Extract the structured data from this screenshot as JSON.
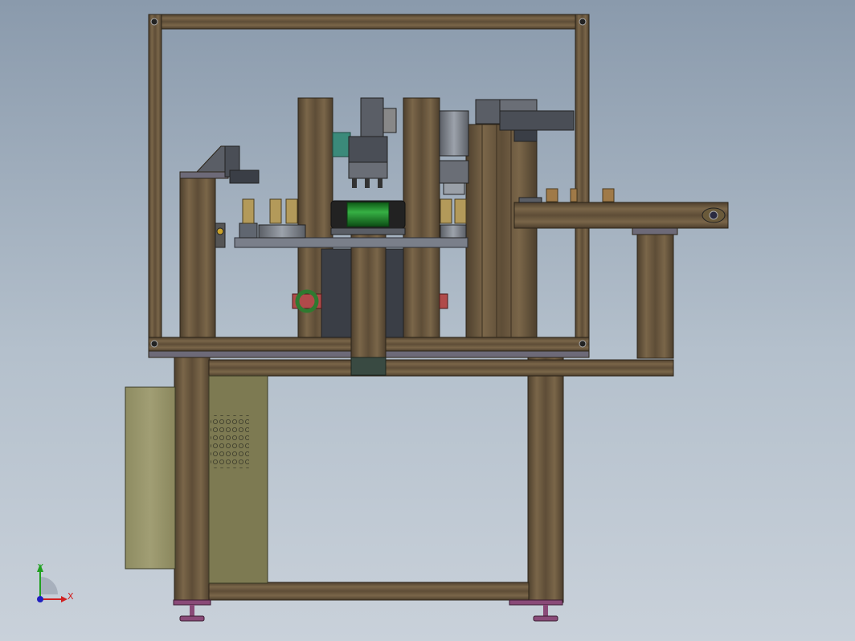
{
  "viewport": {
    "background_top": "#8a9aac",
    "background_bottom": "#c9d1da"
  },
  "colors": {
    "frame": "#6b5a43",
    "frame_dark": "#4a3d2c",
    "plate": "#7a7f8a",
    "cabinet": "#9a9670",
    "cabinet_side": "#7d7a52",
    "roller": "#1f8a2b",
    "foot": "#8a4a78",
    "red_part": "#b04a4a",
    "bronze": "#a07a48"
  },
  "triad": {
    "x_label": "X",
    "y_label": "Y",
    "x_color": "#d02020",
    "y_color": "#20a020",
    "origin_color": "#2020c0"
  }
}
